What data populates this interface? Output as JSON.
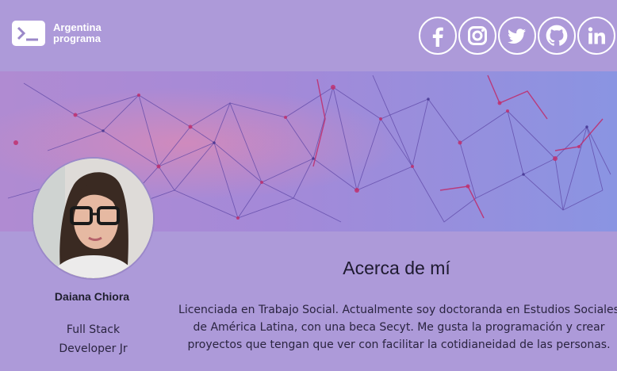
{
  "header": {
    "brand_line1": "Argentina",
    "brand_line2": "programa",
    "socials": [
      {
        "name": "facebook",
        "icon": "facebook-icon"
      },
      {
        "name": "instagram",
        "icon": "instagram-icon"
      },
      {
        "name": "twitter",
        "icon": "twitter-icon"
      },
      {
        "name": "github",
        "icon": "github-icon"
      },
      {
        "name": "linkedin",
        "icon": "linkedin-icon"
      }
    ]
  },
  "profile": {
    "name": "Daiana Chiora",
    "role_line1": "Full Stack",
    "role_line2": "Developer Jr"
  },
  "about": {
    "title": "Acerca de mí",
    "line1": "Licenciada en Trabajo Social. Actualmente soy doctoranda en Estudios Sociales",
    "line2": "de América Latina, con una beca Secyt. Me gusta la programación y crear",
    "line3": "proyectos que tengan que ver con facilitar la cotidianeidad de las personas."
  },
  "colors": {
    "background": "#ad9ad9",
    "banner_start": "#a77fcf",
    "banner_end": "#8a8fe0",
    "network_lines": "#6a4fb0",
    "network_nodes": "#c0306e"
  }
}
